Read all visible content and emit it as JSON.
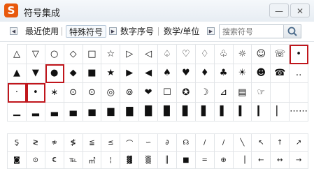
{
  "window": {
    "logo": "S",
    "title": "符号集成",
    "minimize": "—",
    "close": "✕"
  },
  "tabs": {
    "prev": "◀",
    "next": "▶",
    "items": [
      {
        "label": "最近使用",
        "active": false
      },
      {
        "label": "特殊符号",
        "active": true
      },
      {
        "label": "数字序号",
        "active": false
      },
      {
        "label": "数学/单位",
        "active": false
      }
    ]
  },
  "search": {
    "placeholder": "搜索符号",
    "icon": "search-icon"
  },
  "symbols": [
    [
      "△",
      "▽",
      "○",
      "◇",
      "□",
      "☆",
      "▷",
      "◁",
      "♤",
      "♡",
      "♢",
      "♧",
      "☼",
      "☺",
      "☏",
      "•"
    ],
    [
      "▲",
      "▼",
      "●",
      "◆",
      "■",
      "★",
      "▶",
      "◀",
      "♠",
      "♥",
      "♦",
      "♣",
      "☀",
      "☻",
      "☎",
      "‥"
    ],
    [
      "·",
      "•",
      "∗",
      "⊙",
      "⊙",
      "◎",
      "⊚",
      "❤",
      "☐",
      "✪",
      "☽",
      "⊿",
      "▤",
      "☞",
      "",
      ""
    ],
    [
      "▁",
      "▂",
      "▃",
      "▄",
      "▅",
      "▆",
      "▇",
      "█",
      "▉",
      "▊",
      "▋",
      "▌",
      "▍",
      "▎",
      "▏",
      "⋯⋯"
    ]
  ],
  "highlighted": [
    [
      0,
      15
    ],
    [
      1,
      2
    ],
    [
      2,
      0
    ],
    [
      2,
      1
    ]
  ],
  "symbols2": [
    [
      "Ş",
      "≷",
      "≉",
      "≸",
      "≦",
      "≤",
      "⌒",
      "∽",
      "∂",
      "☊",
      "∕",
      "∕",
      "╲",
      "↖",
      "↑",
      "↗"
    ],
    [
      "◙",
      "⊙",
      "€",
      "℡",
      "㎡",
      "¦",
      "▓",
      "▒",
      "║",
      "■",
      "═",
      "⊕",
      "▕",
      "←",
      "↔",
      "→"
    ]
  ]
}
